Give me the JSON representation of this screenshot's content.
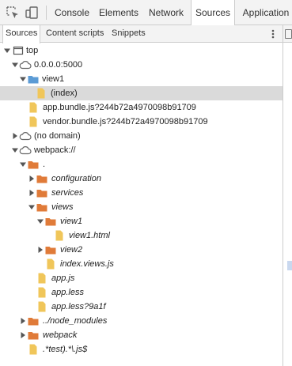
{
  "toolbar": {
    "tabs": [
      {
        "label": "Console"
      },
      {
        "label": "Elements"
      },
      {
        "label": "Network"
      },
      {
        "label": "Sources"
      },
      {
        "label": "Application"
      }
    ],
    "active_tab": "Sources"
  },
  "navigator": {
    "tabs": [
      {
        "label": "Sources"
      },
      {
        "label": "Content scripts"
      },
      {
        "label": "Snippets"
      }
    ],
    "active_tab": "Sources"
  },
  "tree": [
    {
      "label": "top",
      "icon": "frame-icon",
      "expanded": true
    },
    {
      "label": "0.0.0.0:5000",
      "icon": "cloud-icon",
      "expanded": true
    },
    {
      "label": "view1",
      "icon": "folder-icon",
      "expanded": true
    },
    {
      "label": "(index)",
      "icon": "file-icon",
      "selected": true
    },
    {
      "label": "app.bundle.js?244b72a4970098b91709",
      "icon": "file-icon"
    },
    {
      "label": "vendor.bundle.js?244b72a4970098b91709",
      "icon": "file-icon"
    },
    {
      "label": "(no domain)",
      "icon": "cloud-icon",
      "expanded": false
    },
    {
      "label": "webpack://",
      "icon": "cloud-icon",
      "expanded": true
    },
    {
      "label": ".",
      "icon": "folder-icon",
      "expanded": true
    },
    {
      "label": "configuration",
      "icon": "folder-icon",
      "expanded": false
    },
    {
      "label": "services",
      "icon": "folder-icon",
      "expanded": false
    },
    {
      "label": "views",
      "icon": "folder-icon",
      "expanded": true
    },
    {
      "label": "view1",
      "icon": "folder-icon",
      "expanded": true
    },
    {
      "label": "view1.html",
      "icon": "file-icon"
    },
    {
      "label": "view2",
      "icon": "folder-icon",
      "expanded": false
    },
    {
      "label": "index.views.js",
      "icon": "file-icon"
    },
    {
      "label": "app.js",
      "icon": "file-icon"
    },
    {
      "label": "app.less",
      "icon": "file-icon"
    },
    {
      "label": "app.less?9a1f",
      "icon": "file-icon"
    },
    {
      "label": "../node_modules",
      "icon": "folder-icon",
      "expanded": false
    },
    {
      "label": "webpack",
      "icon": "folder-icon",
      "expanded": false
    },
    {
      "label": ".*test).*\\.js$",
      "icon": "file-icon"
    }
  ],
  "colors": {
    "folder_network": "#5b9bd5",
    "folder_webpack": "#e07b39",
    "file": "#f0c65a",
    "selection": "#dadada"
  }
}
